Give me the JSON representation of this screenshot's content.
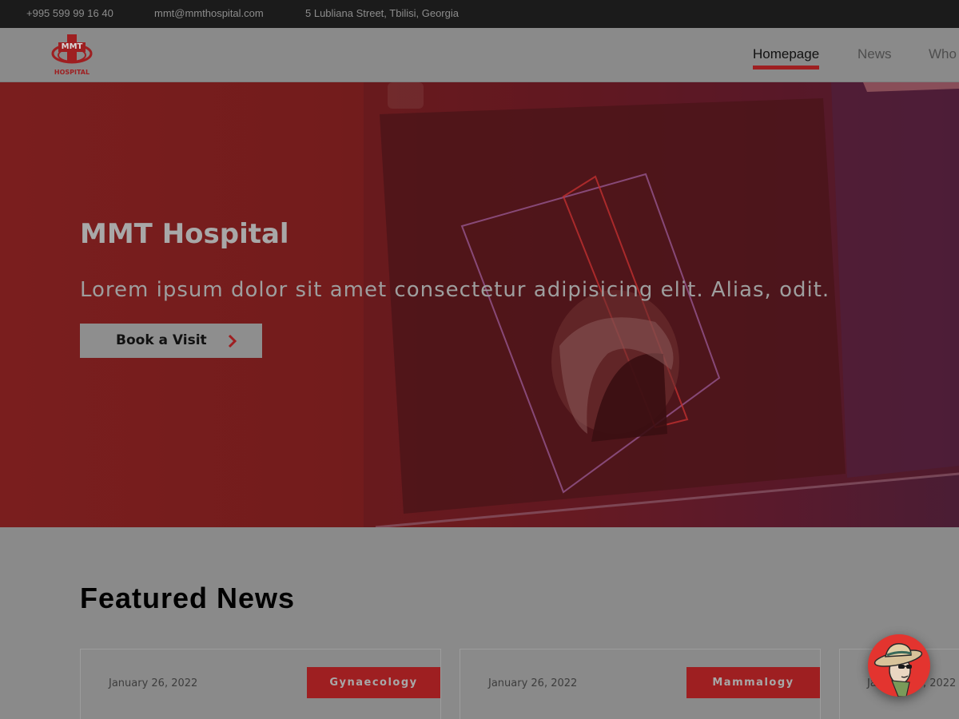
{
  "topbar": {
    "phone": "+995 599 99 16 40",
    "email": "mmt@mmthospital.com",
    "address": "5 Lubliana Street, Tbilisi, Georgia"
  },
  "header": {
    "logo": {
      "text": "MMT",
      "subtext": "HOSPITAL"
    },
    "nav": [
      {
        "label": "Homepage",
        "active": true
      },
      {
        "label": "News",
        "active": false
      },
      {
        "label": "Who",
        "active": false
      }
    ]
  },
  "hero": {
    "title": "MMT Hospital",
    "subtitle": "Lorem ipsum dolor sit amet consectetur adipisicing elit. Alias, odit.",
    "button_label": "Book a Visit",
    "button_icon": "chevron-right-icon"
  },
  "featured": {
    "title": "Featured News",
    "cards": [
      {
        "date": "January 26, 2022",
        "tag": "Gynaecology"
      },
      {
        "date": "January 26, 2022",
        "tag": "Mammalogy"
      },
      {
        "date": "January 26, 2022",
        "tag": ""
      }
    ]
  },
  "floating_avatar": {
    "icon": "user-avatar-icon"
  },
  "colors": {
    "accent": "#9e1f21",
    "topbar_bg": "#1b1b1b",
    "page_bg": "#8a8a8a"
  }
}
